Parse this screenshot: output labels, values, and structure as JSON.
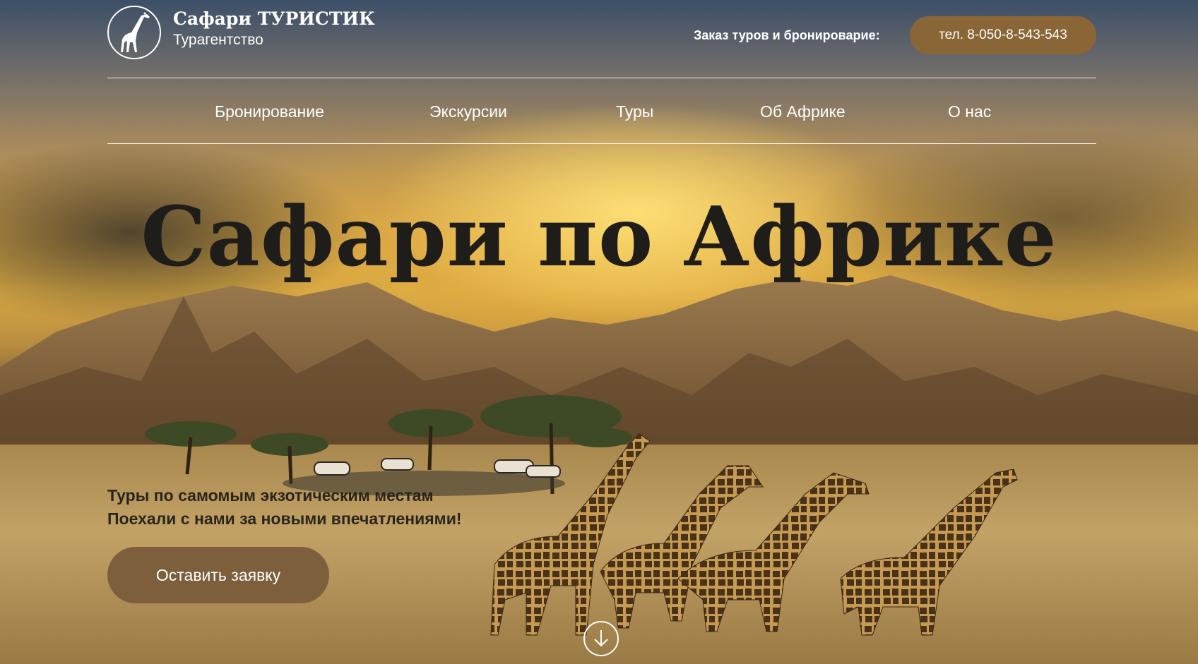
{
  "header": {
    "brand_title": "Сафари ТУРИСТИК",
    "brand_subtitle": "Турагентство",
    "logo_icon": "giraffe-icon",
    "order_label": "Заказ туров и бронироварие:",
    "phone_label": "тел. 8-050-8-543-543"
  },
  "nav": {
    "items": [
      {
        "label": "Бронирование"
      },
      {
        "label": "Экскурсии"
      },
      {
        "label": "Туры"
      },
      {
        "label": "Об Африке"
      },
      {
        "label": "О нас"
      }
    ]
  },
  "hero": {
    "title": "Сафари по Африке",
    "tagline_line1": "Туры по самомым экзотическим местам",
    "tagline_line2": "Поехали с нами за новыми впечатлениями!",
    "cta_label": "Оставить заявку",
    "scroll_icon": "arrow-down-icon"
  },
  "colors": {
    "accent": "#8a6536",
    "cta": "#7d5f3c",
    "title": "#1f1d1a"
  }
}
